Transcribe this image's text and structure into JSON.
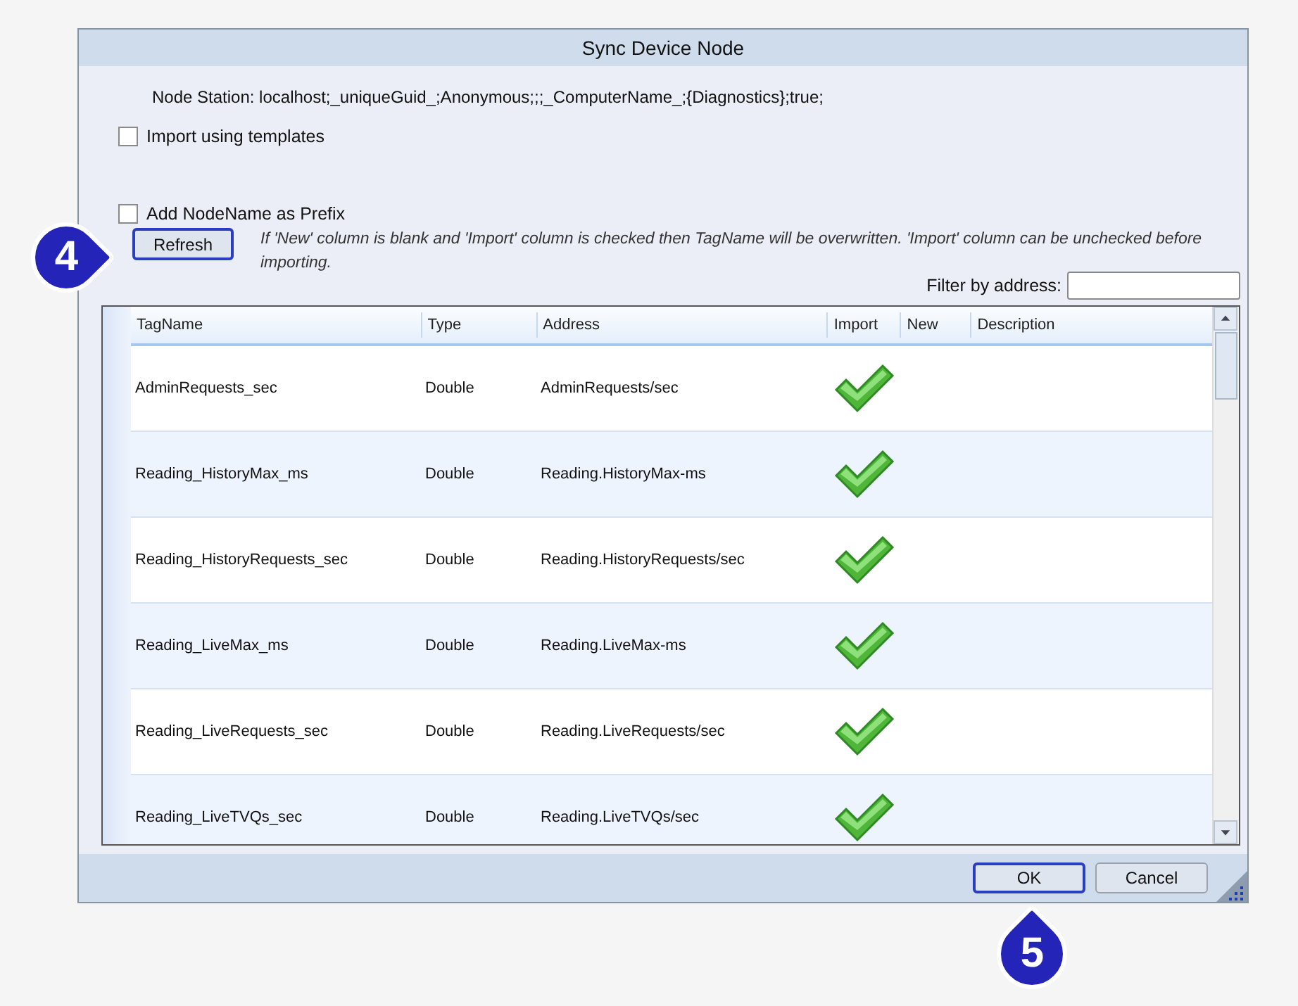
{
  "window": {
    "title": "Sync Device Node"
  },
  "node_station": "Node Station: localhost;_uniqueGuid_;Anonymous;;;_ComputerName_;{Diagnostics};true;",
  "options": [
    {
      "label": "Import using templates",
      "checked": false
    },
    {
      "label": "Add NodeName as Prefix",
      "checked": false
    }
  ],
  "refresh_button": {
    "label": "Refresh",
    "focused": true
  },
  "note": "If 'New' column is blank and 'Import' column is checked then TagName will be overwritten. 'Import' column can be unchecked before importing.",
  "filter": {
    "label": "Filter by address:"
  },
  "table": {
    "columns": [
      "TagName",
      "Type",
      "Address",
      "Import",
      "New",
      "Description"
    ],
    "rows": [
      {
        "tag_name": "AdminRequests_sec",
        "type": "Double",
        "address": "AdminRequests/sec",
        "import": true
      },
      {
        "tag_name": "Reading_HistoryMax_ms",
        "type": "Double",
        "address": "Reading.HistoryMax-ms",
        "import": true
      },
      {
        "tag_name": "Reading_HistoryRequests_sec",
        "type": "Double",
        "address": "Reading.HistoryRequests/sec",
        "import": true
      },
      {
        "tag_name": "Reading_LiveMax_ms",
        "type": "Double",
        "address": "Reading.LiveMax-ms",
        "import": true
      },
      {
        "tag_name": "Reading_LiveRequests_sec",
        "type": "Double",
        "address": "Reading.LiveRequests/sec",
        "import": true
      },
      {
        "tag_name": "Reading_LiveTVQs_sec",
        "type": "Double",
        "address": "Reading.LiveTVQs/sec",
        "import": true
      }
    ]
  },
  "buttons": [
    {
      "label": "OK",
      "focused": true
    },
    {
      "label": "Cancel",
      "focused": false
    }
  ],
  "callouts": [
    "4",
    "5"
  ]
}
